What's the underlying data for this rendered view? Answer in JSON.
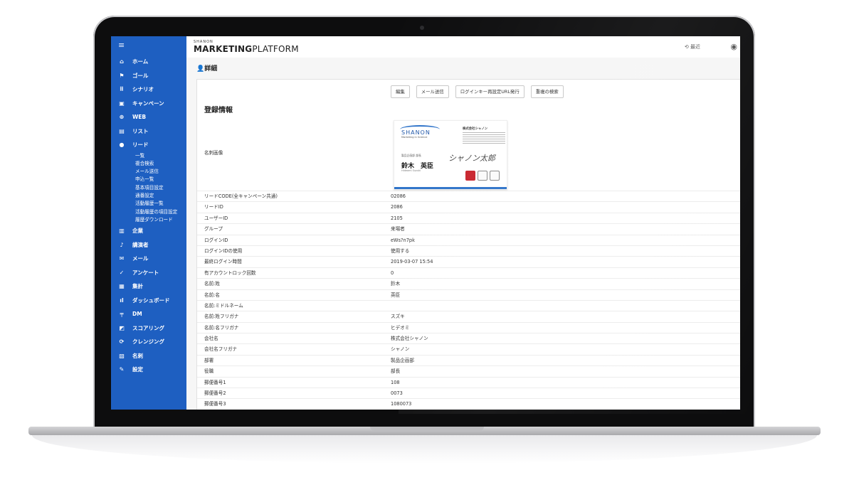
{
  "header": {
    "brand_small": "SHANON",
    "brand_main_a": "MARKETING",
    "brand_main_b": "PLATFORM",
    "recent": "最近"
  },
  "sidebar": {
    "items": [
      {
        "icon": "home-icon",
        "glyph": "⌂",
        "label": "ホーム"
      },
      {
        "icon": "flag-icon",
        "glyph": "⚑",
        "label": "ゴール"
      },
      {
        "icon": "scenario-icon",
        "glyph": "⠿",
        "label": "シナリオ"
      },
      {
        "icon": "calendar-icon",
        "glyph": "▣",
        "label": "キャンペーン"
      },
      {
        "icon": "globe-icon",
        "glyph": "⊕",
        "label": "WEB"
      },
      {
        "icon": "list-icon",
        "glyph": "▤",
        "label": "リスト"
      },
      {
        "icon": "person-icon",
        "glyph": "●",
        "label": "リード"
      }
    ],
    "lead_sub": [
      "一覧",
      "複合検索",
      "メール送信",
      "申込一覧",
      "基本項目設定",
      "通番設定",
      "活動履歴一覧",
      "活動履歴の項目設定",
      "履歴ダウンロード"
    ],
    "items2": [
      {
        "icon": "building-icon",
        "glyph": "▥",
        "label": "企業"
      },
      {
        "icon": "microphone-icon",
        "glyph": "♪",
        "label": "講演者"
      },
      {
        "icon": "mail-icon",
        "glyph": "✉",
        "label": "メール"
      },
      {
        "icon": "check-icon",
        "glyph": "✓",
        "label": "アンケート"
      },
      {
        "icon": "tally-icon",
        "glyph": "▦",
        "label": "集計"
      },
      {
        "icon": "bar-chart-icon",
        "glyph": "ıl",
        "label": "ダッシュボード"
      },
      {
        "icon": "dm-icon",
        "glyph": "╤",
        "label": "DM"
      },
      {
        "icon": "score-icon",
        "glyph": "◩",
        "label": "スコアリング"
      },
      {
        "icon": "cleansing-icon",
        "glyph": "⟳",
        "label": "クレンジング"
      },
      {
        "icon": "card-icon",
        "glyph": "▧",
        "label": "名刺"
      },
      {
        "icon": "wrench-icon",
        "glyph": "✎",
        "label": "設定"
      }
    ]
  },
  "page": {
    "heading": "詳細",
    "buttons": [
      "編集",
      "メール送信",
      "ログインキー再設定URL発行",
      "重複の検索"
    ],
    "section_title": "登録情報",
    "bcard_label": "名刺画像"
  },
  "business_card": {
    "logo": "SHANON",
    "tagline": "Marketing in Science",
    "company": "株式会社シャノン",
    "title": "製品企画部 部長",
    "name": "鈴木　英臣",
    "roman": "Hideomi Suzuki",
    "signature": "シャノン太郎"
  },
  "fields": [
    {
      "k": "リードCODE(全キャンペーン共通)",
      "v": "02086"
    },
    {
      "k": "リードID",
      "v": "2086"
    },
    {
      "k": "ユーザーID",
      "v": "2105"
    },
    {
      "k": "グループ",
      "v": "来場者"
    },
    {
      "k": "ログインID",
      "v": "eWs?n7pk"
    },
    {
      "k": "ログインIDの使用",
      "v": "使用する"
    },
    {
      "k": "最終ログイン時間",
      "v": "2019-03-07 15:54"
    },
    {
      "k": "有アカウントロック回数",
      "v": "0"
    },
    {
      "k": "名前:姓",
      "v": "鈴木"
    },
    {
      "k": "名前:名",
      "v": "英臣"
    },
    {
      "k": "名前:ミドルネーム",
      "v": ""
    },
    {
      "k": "名前:姓フリガナ",
      "v": "スズキ"
    },
    {
      "k": "名前:名フリガナ",
      "v": "ヒデオミ"
    },
    {
      "k": "会社名",
      "v": "株式会社シャノン"
    },
    {
      "k": "会社名フリガナ",
      "v": "シャノン"
    },
    {
      "k": "部署",
      "v": "製品企画部"
    },
    {
      "k": "役職",
      "v": "部長"
    },
    {
      "k": "郵便番号1",
      "v": "108"
    },
    {
      "k": "郵便番号2",
      "v": "0073"
    },
    {
      "k": "郵便番号3",
      "v": "1080073"
    },
    {
      "k": "国名",
      "v": ""
    }
  ]
}
